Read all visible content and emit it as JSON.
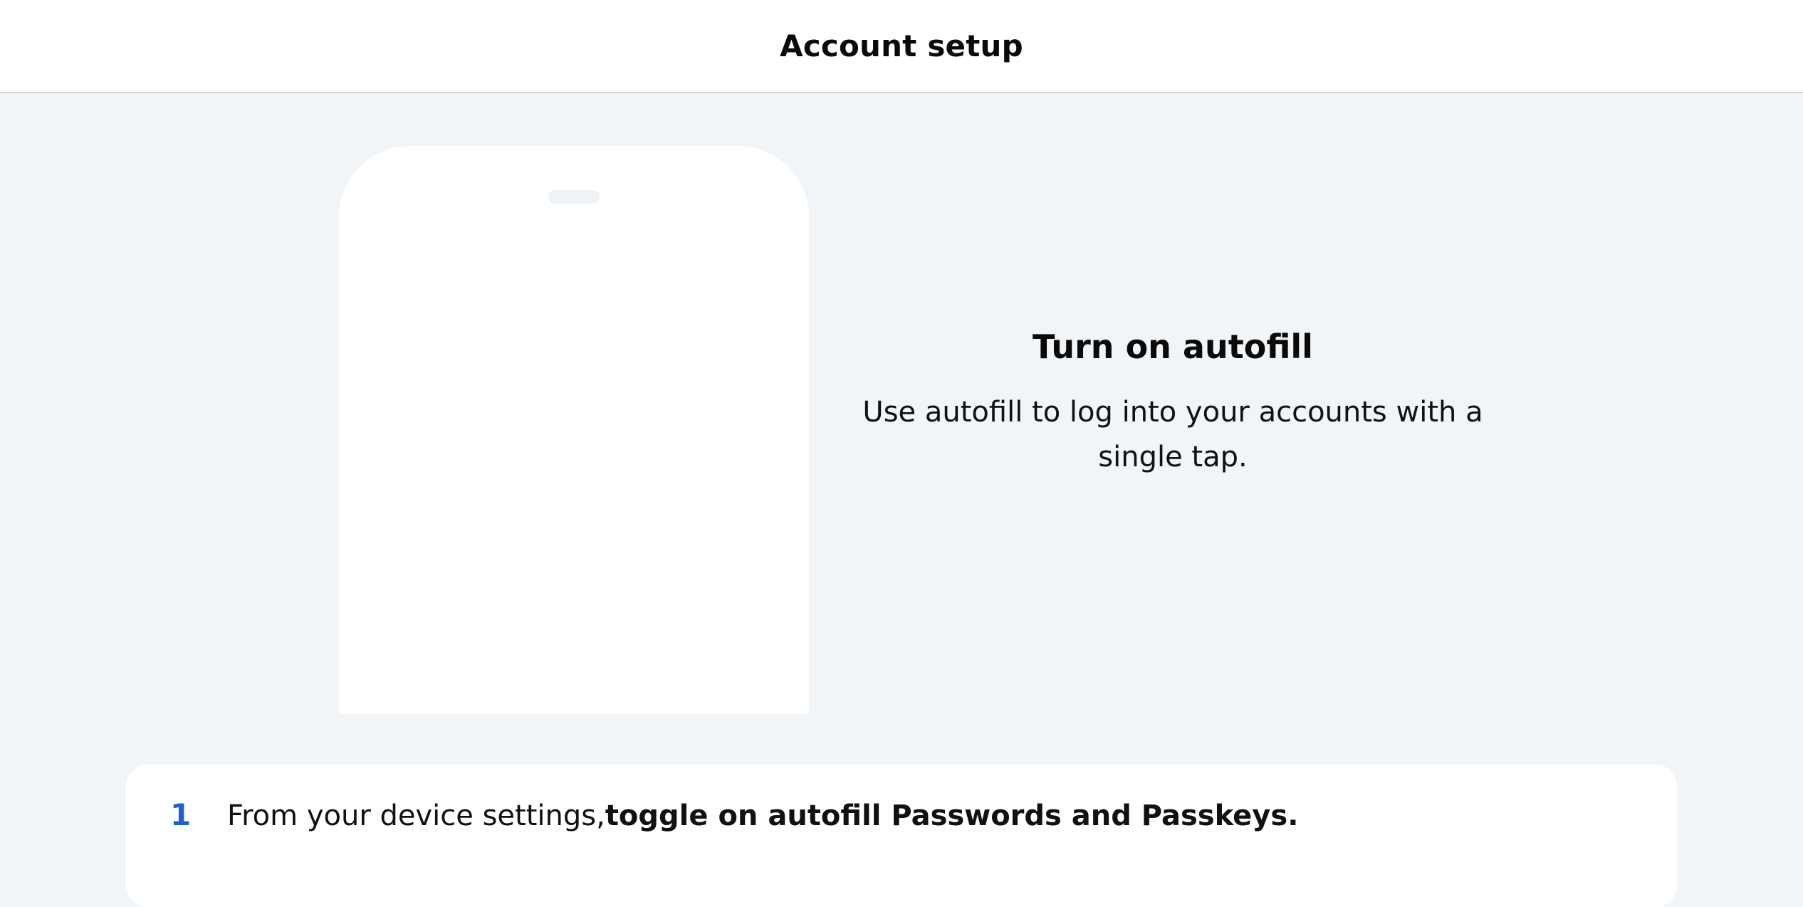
{
  "header": {
    "title": "Account setup"
  },
  "hero": {
    "title": "Turn on autofill",
    "subtitle": "Use autofill to log into your accounts with a single tap."
  },
  "steps": [
    {
      "number": "1",
      "text": "From your device settings, ",
      "bold_text": "toggle on autofill Passwords and Passkeys."
    }
  ],
  "colors": {
    "background": "#f1f5f8",
    "surface": "#ffffff",
    "accent": "#1f5fce",
    "divider": "#d4d9df"
  }
}
